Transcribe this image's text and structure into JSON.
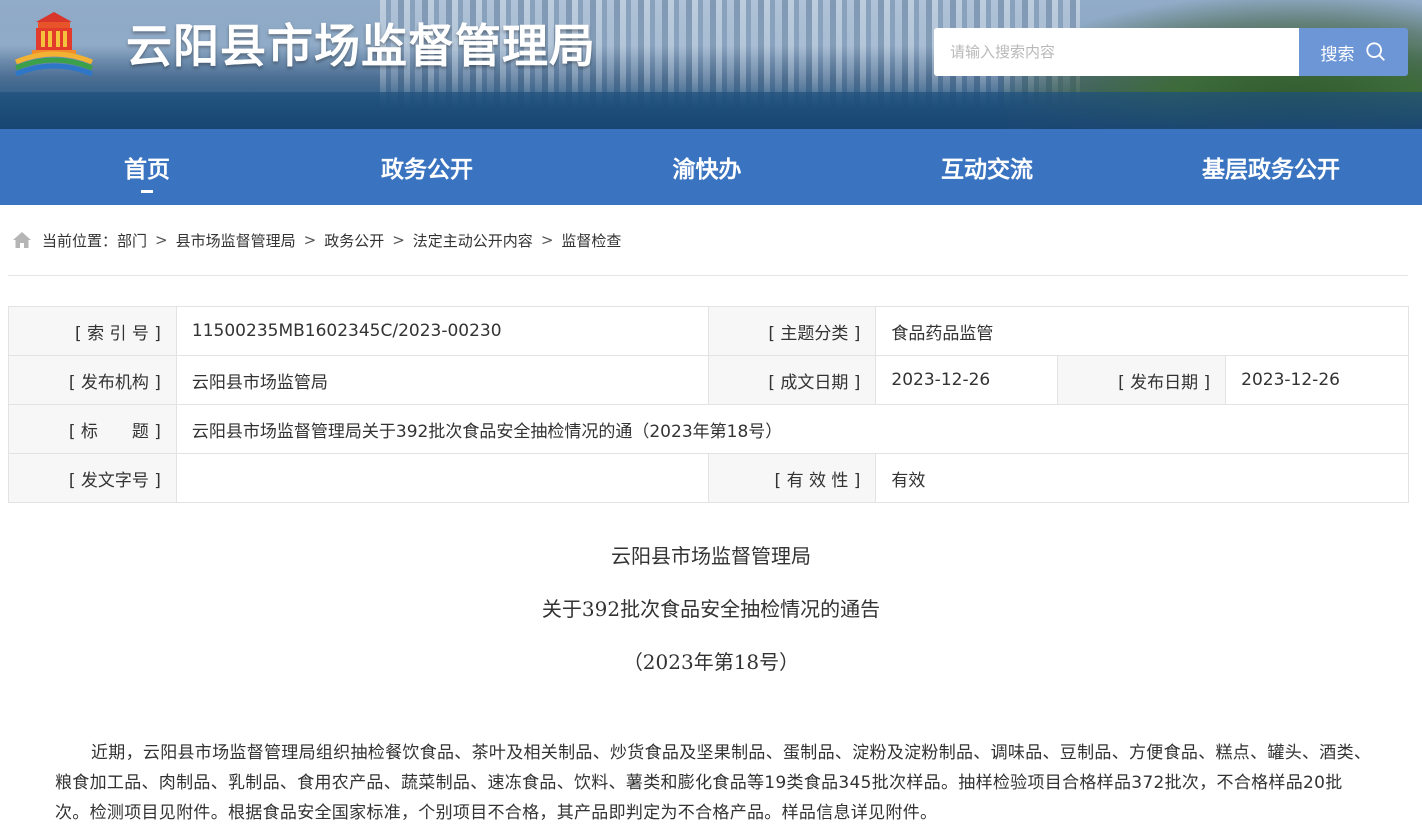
{
  "header": {
    "site_title": "云阳县市场监督管理局",
    "search": {
      "placeholder": "请输入搜索内容",
      "button_label": "搜索"
    }
  },
  "nav": {
    "items": [
      {
        "label": "首页",
        "active": true
      },
      {
        "label": "政务公开",
        "active": false
      },
      {
        "label": "渝快办",
        "active": false
      },
      {
        "label": "互动交流",
        "active": false
      },
      {
        "label": "基层政务公开",
        "active": false
      }
    ]
  },
  "breadcrumb": {
    "prefix": "当前位置：",
    "items": [
      "部门",
      "县市场监督管理局",
      "政务公开",
      "法定主动公开内容",
      "监督检查"
    ],
    "separator": ">"
  },
  "info": {
    "index_label": "[ 索 引 号 ]",
    "index_value": "11500235MB1602345C/2023-00230",
    "subject_label": "[ 主题分类 ]",
    "subject_value": "食品药品监管",
    "publisher_label": "[ 发布机构 ]",
    "publisher_value": "云阳县市场监管局",
    "created_label": "[ 成文日期 ]",
    "created_value": "2023-12-26",
    "published_label": "[ 发布日期 ]",
    "published_value": "2023-12-26",
    "title_label": "[ 标　　题 ]",
    "title_value": "云阳县市场监督管理局关于392批次食品安全抽检情况的通（2023年第18号）",
    "doc_no_label": "[ 发文字号 ]",
    "doc_no_value": "",
    "validity_label": "[ 有 效 性 ]",
    "validity_value": "有效"
  },
  "article": {
    "title_line1": "云阳县市场监督管理局",
    "title_line2": "关于392批次食品安全抽检情况的通告",
    "title_line3": "（2023年第18号）",
    "paragraph1": "近期，云阳县市场监督管理局组织抽检餐饮食品、茶叶及相关制品、炒货食品及坚果制品、蛋制品、淀粉及淀粉制品、调味品、豆制品、方便食品、糕点、罐头、酒类、粮食加工品、肉制品、乳制品、食用农产品、蔬菜制品、速冻食品、饮料、薯类和膨化食品等19类食品345批次样品。抽样检验项目合格样品372批次，不合格样品20批次。检测项目见附件。根据食品安全国家标准，个别项目不合格，其产品即判定为不合格产品。样品信息详见附件。"
  },
  "colors": {
    "nav_bg": "#3a74c0",
    "search_button_bg": "#6d96d7",
    "banner_text": "#ffffff"
  },
  "icons": {
    "logo": "government-emblem-logo",
    "search": "search-icon",
    "home": "home-icon"
  }
}
